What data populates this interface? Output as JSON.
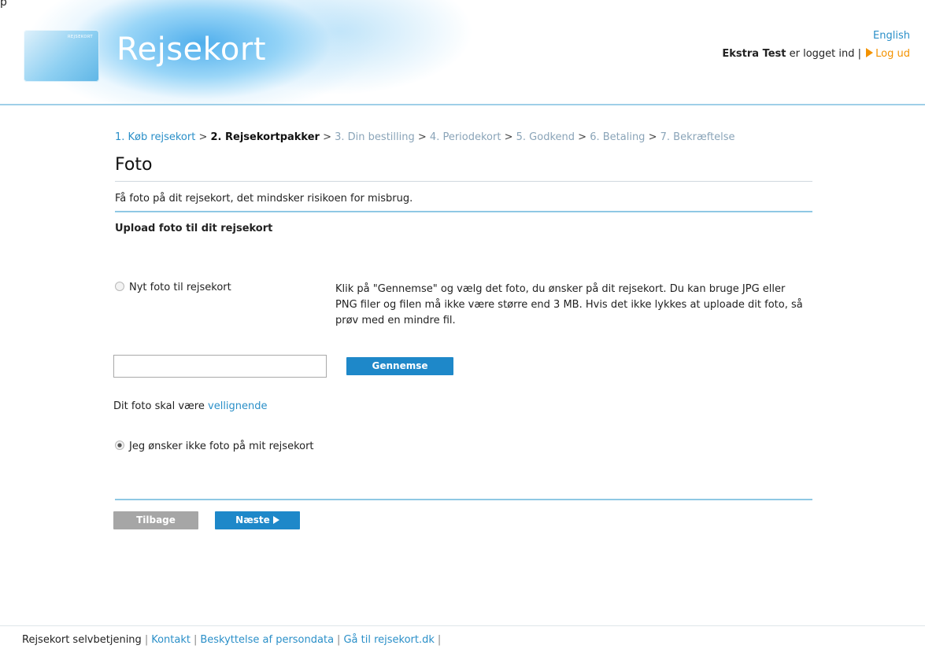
{
  "header": {
    "logo_card_text": "REJSEKORT",
    "brand": "Rejsekort",
    "language_link": "English",
    "user_name": "Ekstra Test",
    "logged_in_text": "er logget ind |",
    "logout_label": "Log ud",
    "top_fragment": "p"
  },
  "steps": {
    "step1": "1. Køb rejsekort",
    "sep": ">",
    "step2": "2. Rejsekortpakker",
    "step3": "3. Din bestilling",
    "step4": "4. Periodekort",
    "step5": "5. Godkend",
    "step6": "6. Betaling",
    "step7": "7. Bekræftelse"
  },
  "page": {
    "title": "Foto",
    "intro": "Få foto på dit rejsekort, det mindsker risikoen for misbrug.",
    "section_title": "Upload foto til dit rejsekort",
    "option_new_photo": "Nyt foto til rejsekort",
    "info_text": "Klik på \"Gennemse\" og vælg det foto, du ønsker på dit rejsekort. Du kan bruge JPG eller PNG filer og filen må ikke være større end 3 MB. Hvis det ikke lykkes at uploade dit foto, så prøv med en mindre fil.",
    "file_input_value": "",
    "browse_label": "Gennemse",
    "requirement_text": "Dit foto skal være",
    "requirement_link": "vellignende",
    "option_no_photo": "Jeg ønsker ikke foto på mit rejsekort",
    "selected_option": "no_photo",
    "back_label": "Tilbage",
    "next_label": "Næste"
  },
  "footer": {
    "site_name": "Rejsekort selvbetjening",
    "contact": "Kontakt",
    "privacy": "Beskyttelse af persondata",
    "goto": "Gå til rejsekort.dk",
    "pipe": "|"
  },
  "colors": {
    "link_blue": "#2a8fc8",
    "button_blue": "#1e88c9",
    "logout_orange": "#f39200",
    "disabled_gray": "#a6a6a6"
  },
  "icons": {
    "logout": "play-triangle-icon",
    "next": "play-triangle-icon"
  }
}
